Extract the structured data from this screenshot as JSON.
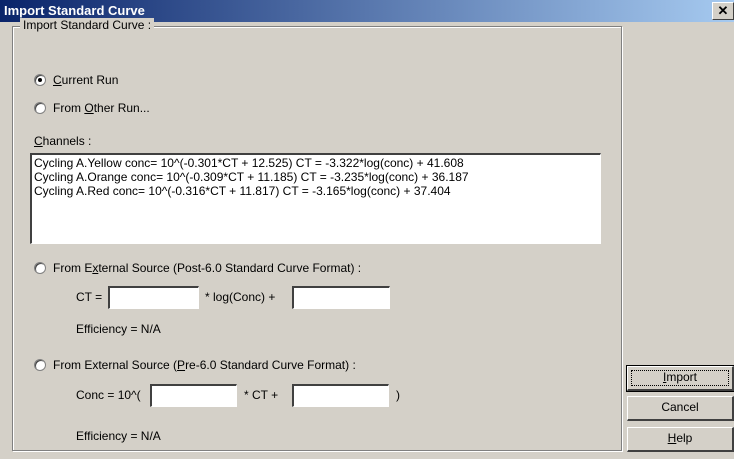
{
  "window": {
    "title": "Import Standard Curve",
    "close_glyph": "✕"
  },
  "group": {
    "legend": "Import Standard Curve :"
  },
  "options": {
    "current_run": {
      "pre": "",
      "mnemonic": "C",
      "post": "urrent Run",
      "checked": true
    },
    "other_run": {
      "pre": "From ",
      "mnemonic": "O",
      "post": "ther Run...",
      "checked": false
    },
    "external_post": {
      "pre": "From E",
      "mnemonic": "x",
      "post": "ternal Source (Post-6.0 Standard Curve Format) :",
      "checked": false
    },
    "external_pre": {
      "pre": "From External Source (",
      "mnemonic": "P",
      "post": "re-6.0 Standard Curve Format) :",
      "checked": false
    }
  },
  "channels": {
    "label_mnemonic": "C",
    "label_rest": "hannels :",
    "items": [
      "Cycling A.Yellow  conc= 10^(-0.301*CT + 12.525)  CT = -3.322*log(conc) + 41.608",
      "Cycling A.Orange  conc= 10^(-0.309*CT + 11.185)  CT = -3.235*log(conc) + 36.187",
      "Cycling A.Red  conc= 10^(-0.316*CT + 11.817)  CT = -3.165*log(conc) + 37.404"
    ]
  },
  "post_format": {
    "ct_label": "CT =",
    "mid_label": "* log(Conc) +",
    "slope_value": "",
    "intercept_value": "",
    "efficiency": "Efficiency = N/A"
  },
  "pre_format": {
    "conc_label": "Conc = 10^(",
    "mid_label": "* CT +",
    "close_paren": ")",
    "slope_value": "",
    "intercept_value": "",
    "efficiency": "Efficiency = N/A"
  },
  "buttons": {
    "import": {
      "pre": "",
      "mnemonic": "I",
      "post": "mport"
    },
    "cancel": "Cancel",
    "help": {
      "pre": "",
      "mnemonic": "H",
      "post": "elp"
    }
  }
}
